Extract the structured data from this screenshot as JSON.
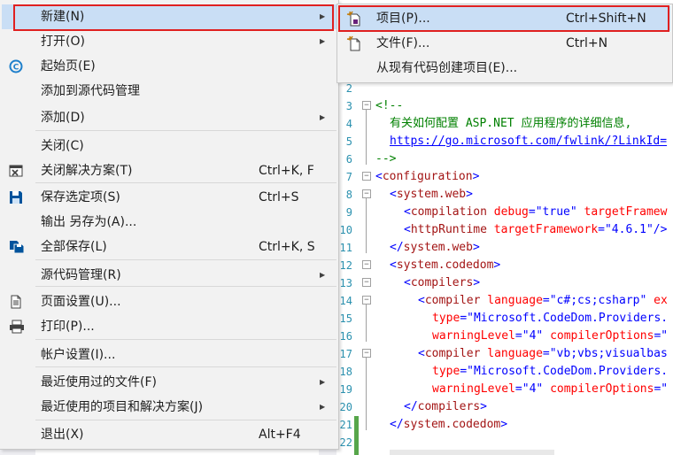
{
  "main_menu": {
    "items": [
      {
        "label": "新建(N)",
        "shortcut": "",
        "submenu": true
      },
      {
        "label": "打开(O)",
        "shortcut": "",
        "submenu": true
      },
      {
        "label": "起始页(E)",
        "shortcut": "",
        "submenu": false
      },
      {
        "label": "添加到源代码管理",
        "shortcut": "",
        "submenu": false
      },
      {
        "label": "添加(D)",
        "shortcut": "",
        "submenu": true
      },
      {
        "label": "关闭(C)",
        "shortcut": "",
        "submenu": false
      },
      {
        "label": "关闭解决方案(T)",
        "shortcut": "Ctrl+K, F",
        "submenu": false
      },
      {
        "label": "保存选定项(S)",
        "shortcut": "Ctrl+S",
        "submenu": false
      },
      {
        "label": "输出 另存为(A)...",
        "shortcut": "",
        "submenu": false
      },
      {
        "label": "全部保存(L)",
        "shortcut": "Ctrl+K, S",
        "submenu": false
      },
      {
        "label": "源代码管理(R)",
        "shortcut": "",
        "submenu": true
      },
      {
        "label": "页面设置(U)...",
        "shortcut": "",
        "submenu": false
      },
      {
        "label": "打印(P)...",
        "shortcut": "",
        "submenu": false
      },
      {
        "label": "帐户设置(I)...",
        "shortcut": "",
        "submenu": false
      },
      {
        "label": "最近使用过的文件(F)",
        "shortcut": "",
        "submenu": true
      },
      {
        "label": "最近使用的项目和解决方案(J)",
        "shortcut": "",
        "submenu": true
      },
      {
        "label": "退出(X)",
        "shortcut": "Alt+F4",
        "submenu": false
      }
    ]
  },
  "sub_menu": {
    "items": [
      {
        "label": "项目(P)...",
        "shortcut": "Ctrl+Shift+N"
      },
      {
        "label": "文件(F)...",
        "shortcut": "Ctrl+N"
      },
      {
        "label": "从现有代码创建项目(E)...",
        "shortcut": ""
      }
    ]
  },
  "editor": {
    "line_numbers": [
      "2",
      "3",
      "4",
      "5",
      "6",
      "7",
      "8",
      "9",
      "10",
      "11",
      "12",
      "13",
      "14",
      "15",
      "16",
      "17",
      "18",
      "19",
      "20",
      "21",
      "22"
    ],
    "lines": {
      "l3": "<!--",
      "l4": "有关如何配置 ASP.NET 应用程序的详细信息,",
      "l5": "https://go.microsoft.com/fwlink/?LinkId=",
      "l6": "-->",
      "l7_tag": "configuration",
      "l8_tag": "system.web",
      "l9_tag": "compilation",
      "l9_attr1": "debug",
      "l9_val1": "\"true\"",
      "l9_attr2": "targetFramew",
      "l10_tag": "httpRuntime",
      "l10_attr1": "targetFramework",
      "l10_val1": "\"4.6.1\"",
      "l11_tag": "system.web",
      "l12_tag": "system.codedom",
      "l13_tag": "compilers",
      "l14_tag": "compiler",
      "l14_attr1": "language",
      "l14_val1": "\"c#;cs;csharp\"",
      "l14_attr2": "ex",
      "l15_attr": "type",
      "l15_val": "\"Microsoft.CodeDom.Providers.",
      "l16_attr1": "warningLevel",
      "l16_val1": "\"4\"",
      "l16_attr2": "compilerOptions",
      "l16_val2": "\"",
      "l17_tag": "compiler",
      "l17_attr1": "language",
      "l17_val1": "\"vb;vbs;visualbas",
      "l18_attr": "type",
      "l18_val": "\"Microsoft.CodeDom.Providers.",
      "l19_attr1": "warningLevel",
      "l19_val1": "\"4\"",
      "l19_attr2": "compilerOptions",
      "l19_val2": "\"",
      "l20_tag": "compilers",
      "l21_tag": "system.codedom"
    }
  },
  "colors": {
    "menu_bg": "#f2f2f2",
    "highlight": "#c9def5",
    "outline": "#e02020",
    "line_number": "#2b91af",
    "tag": "#a31515",
    "attribute": "#ff0000",
    "value": "#0000ff",
    "comment": "#008000"
  }
}
